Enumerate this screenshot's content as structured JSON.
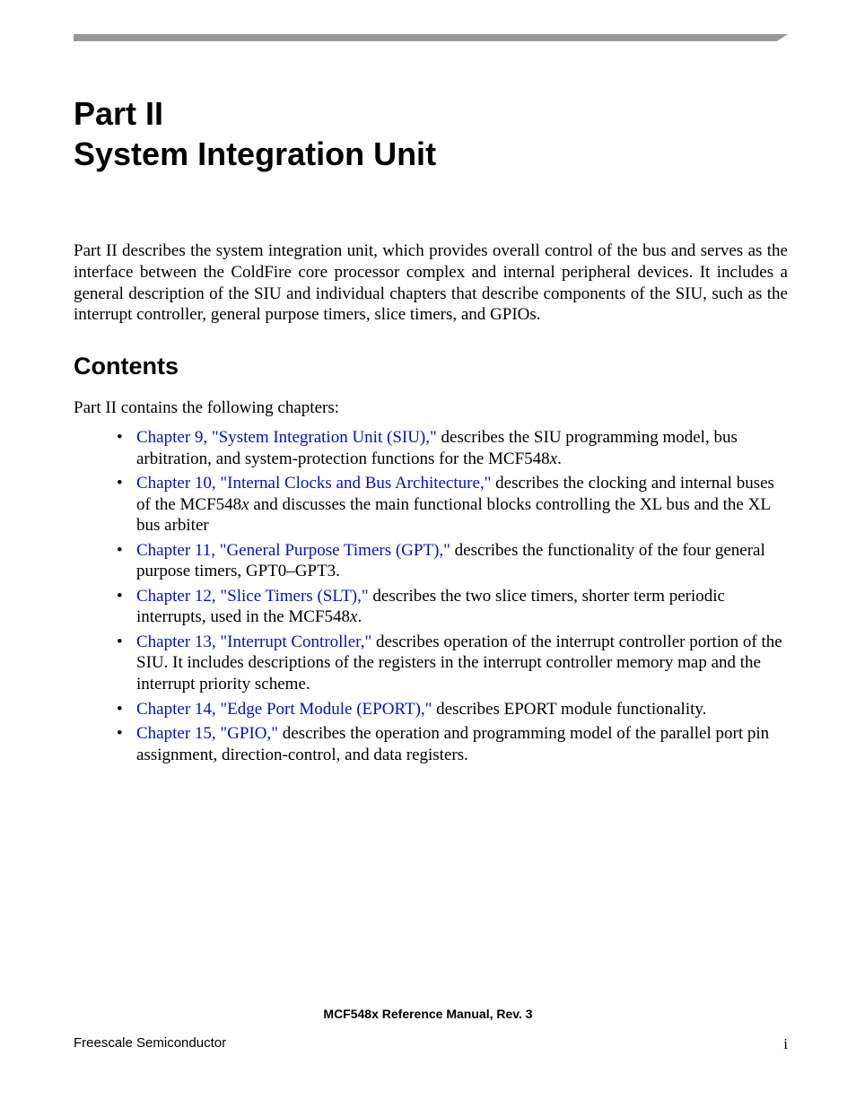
{
  "title": {
    "line1": "Part II",
    "line2": "System Integration Unit"
  },
  "intro": "Part II describes the system integration unit, which provides overall control of the bus and serves as the interface between the ColdFire core processor complex and internal peripheral devices. It includes a general description of the SIU and individual chapters that describe components of the SIU, such as the interrupt controller, general purpose timers, slice timers, and GPIOs.",
  "contents": {
    "heading": "Contents",
    "intro": "Part II contains the following chapters:",
    "items": [
      {
        "link": "Chapter 9, \"System Integration Unit (SIU),\"",
        "desc_before": " describes the SIU programming model, bus arbitration, and system-protection functions for the MCF548",
        "italic": "x",
        "desc_after": "."
      },
      {
        "link": "Chapter 10, \"Internal Clocks and Bus Architecture,\"",
        "desc_before": " describes the clocking and internal buses of the MCF548",
        "italic": "x",
        "desc_after": " and discusses the main functional blocks controlling the XL bus and the XL bus arbiter"
      },
      {
        "link": "Chapter 11, \"General Purpose Timers (GPT),\"",
        "desc_before": " describes the functionality of the four general purpose timers, GPT0–GPT3.",
        "italic": "",
        "desc_after": ""
      },
      {
        "link": "Chapter 12, \"Slice Timers (SLT),\"",
        "desc_before": " describes the two slice timers, shorter term periodic interrupts, used in the MCF548",
        "italic": "x",
        "desc_after": "."
      },
      {
        "link": "Chapter 13, \"Interrupt Controller,\"",
        "desc_before": " describes operation of the interrupt controller portion of the SIU. It includes descriptions of the registers in the interrupt controller memory map and the interrupt priority scheme.",
        "italic": "",
        "desc_after": ""
      },
      {
        "link": "Chapter 14, \"Edge Port Module (EPORT),\"",
        "desc_before": " describes EPORT module functionality.",
        "italic": "",
        "desc_after": ""
      },
      {
        "link": "Chapter 15, \"GPIO,\"",
        "desc_before": " describes the operation and programming model of the parallel port pin assignment, direction-control, and data registers.",
        "italic": "",
        "desc_after": ""
      }
    ]
  },
  "footer": {
    "title": "MCF548x Reference Manual, Rev. 3",
    "left": "Freescale Semiconductor",
    "right": "i"
  }
}
